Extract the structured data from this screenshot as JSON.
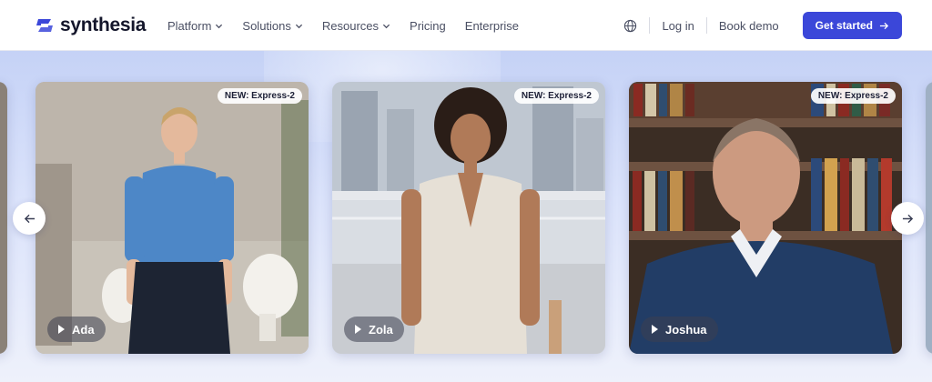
{
  "header": {
    "brand": "synthesia",
    "nav": [
      {
        "label": "Platform",
        "has_dropdown": true
      },
      {
        "label": "Solutions",
        "has_dropdown": true
      },
      {
        "label": "Resources",
        "has_dropdown": true
      },
      {
        "label": "Pricing",
        "has_dropdown": false
      },
      {
        "label": "Enterprise",
        "has_dropdown": false
      }
    ],
    "language_icon": "globe-icon",
    "login": "Log in",
    "book_demo": "Book demo",
    "cta": "Get started"
  },
  "carousel": {
    "prev_icon": "arrow-left-icon",
    "next_icon": "arrow-right-icon",
    "cards": [
      {
        "badge": "NEW: Express-2",
        "name": "Ada"
      },
      {
        "badge": "NEW: Express-2",
        "name": "Zola"
      },
      {
        "badge": "NEW: Express-2",
        "name": "Joshua"
      }
    ]
  },
  "colors": {
    "brand_blue": "#3b47d9",
    "hero_top": "#c5d2f6",
    "hero_bottom": "#eef1fb"
  }
}
